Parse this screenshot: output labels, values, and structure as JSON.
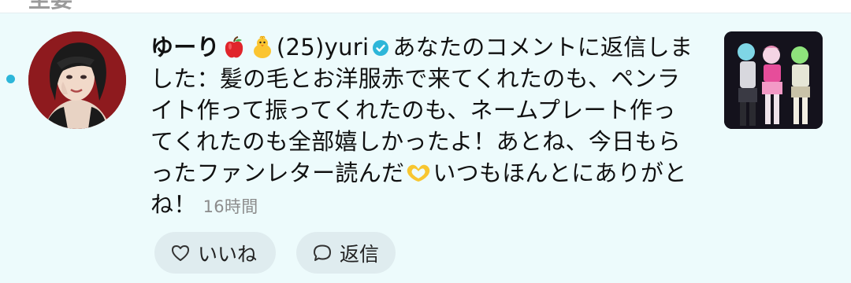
{
  "notification": {
    "header_clipped": "至要",
    "unread": true,
    "username": "ゆーり",
    "name_emoji_1": "apple-emoji",
    "name_emoji_2": "chick-emoji",
    "handle": "(25)yuri",
    "verified_icon": "verified-badge-icon",
    "action_text": "あなたのコメントに返信しました：",
    "reply_text_part1": "髪の毛とお洋服赤で来てくれたのも、ペンライト作って振ってくれたのも、ネームプレート作ってくれたのも全部嬉しかったよ！あとね、今日もらったファンレター読んだ",
    "reply_emoji": "heart-hands-emoji",
    "reply_text_part2": "いつもほんとにありがとね！",
    "timestamp": "16時間",
    "accent_color": "#2db6d9"
  },
  "actions": {
    "like_label": "いいね",
    "reply_label": "返信"
  }
}
